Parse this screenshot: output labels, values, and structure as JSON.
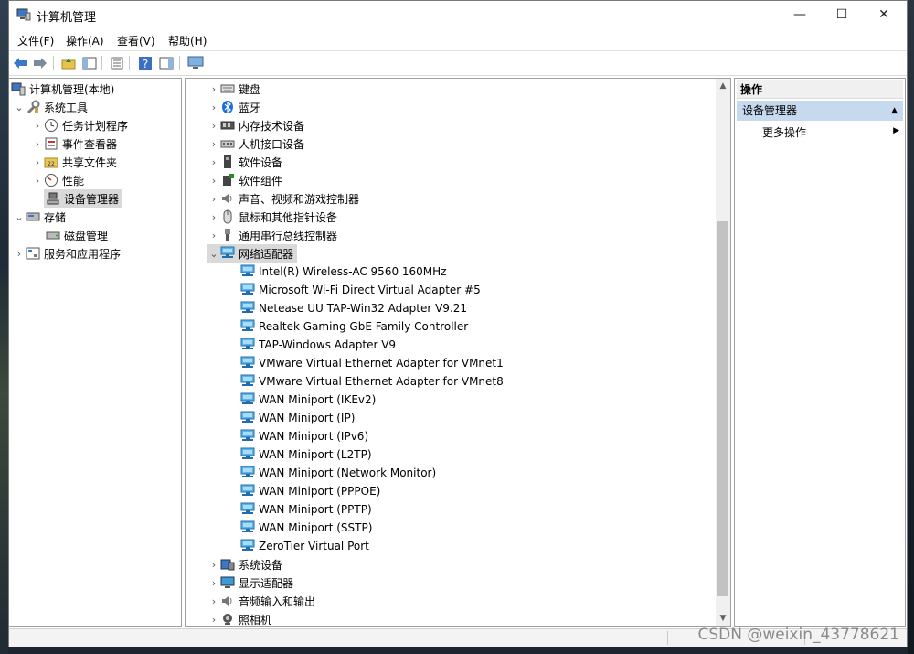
{
  "window": {
    "title": "计算机管理",
    "minimize": "—",
    "maximize": "☐",
    "close": "✕"
  },
  "menu": [
    "文件(F)",
    "操作(A)",
    "查看(V)",
    "帮助(H)"
  ],
  "tree": {
    "root": "计算机管理(本地)",
    "system_tools": "系统工具",
    "task_scheduler": "任务计划程序",
    "event_viewer": "事件查看器",
    "shared_folders": "共享文件夹",
    "performance": "性能",
    "device_manager": "设备管理器",
    "storage": "存储",
    "disk_management": "磁盘管理",
    "services_apps": "服务和应用程序"
  },
  "devices": {
    "categories_top": [
      "键盘",
      "蓝牙",
      "内存技术设备",
      "人机接口设备",
      "软件设备",
      "软件组件",
      "声音、视频和游戏控制器",
      "鼠标和其他指针设备",
      "通用串行总线控制器"
    ],
    "network_adapters": "网络适配器",
    "adapters": [
      "Intel(R) Wireless-AC 9560 160MHz",
      "Microsoft Wi-Fi Direct Virtual Adapter #5",
      "Netease UU TAP-Win32 Adapter V9.21",
      "Realtek Gaming GbE Family Controller",
      "TAP-Windows Adapter V9",
      "VMware Virtual Ethernet Adapter for VMnet1",
      "VMware Virtual Ethernet Adapter for VMnet8",
      "WAN Miniport (IKEv2)",
      "WAN Miniport (IP)",
      "WAN Miniport (IPv6)",
      "WAN Miniport (L2TP)",
      "WAN Miniport (Network Monitor)",
      "WAN Miniport (PPPOE)",
      "WAN Miniport (PPTP)",
      "WAN Miniport (SSTP)",
      "ZeroTier Virtual Port"
    ],
    "categories_bottom": [
      "系统设备",
      "显示适配器",
      "音频输入和输出",
      "照相机"
    ]
  },
  "actions": {
    "header": "操作",
    "section": "设备管理器",
    "more": "更多操作"
  },
  "watermark": "CSDN @weixin_43778621",
  "colors": {
    "selection": "#d9d9d9",
    "action_section": "#c6d9ee",
    "adapter_icon": "#2f8fd0"
  }
}
